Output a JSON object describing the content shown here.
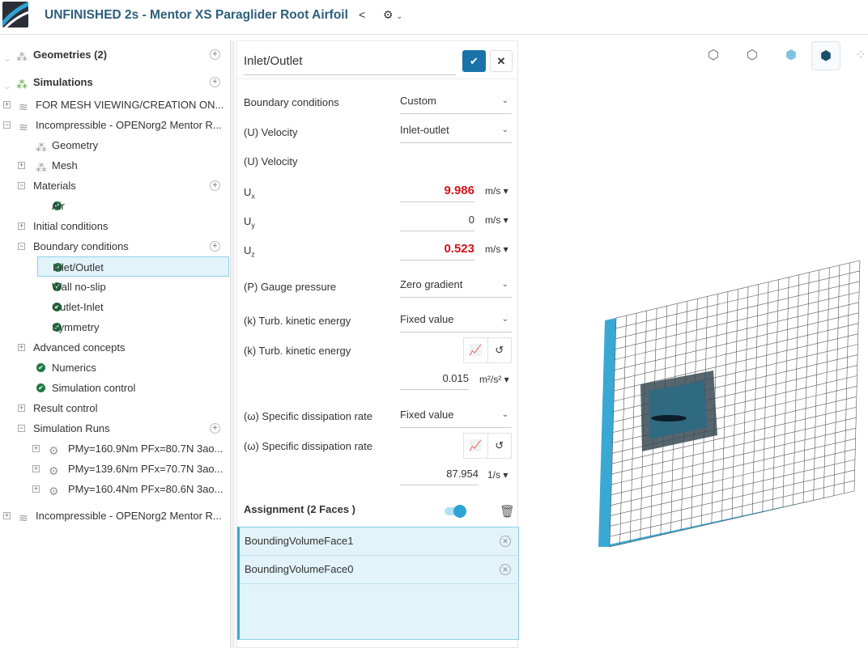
{
  "header": {
    "title": "UNFINISHED 2s - Mentor XS Paraglider Root Airfoil"
  },
  "tree": [
    {
      "label": "Geometries (2)",
      "level": 0,
      "bold": true,
      "icon": "geometry-icon",
      "plus": true,
      "collapse": true
    },
    {
      "label": "Simulations",
      "level": 0,
      "bold": true,
      "icon": "simulations-icon",
      "plus": true,
      "collapse": true
    },
    {
      "label": "FOR MESH VIEWING/CREATION ON...",
      "level": 1,
      "exp": "+",
      "icon": "layers-icon"
    },
    {
      "label": "Incompressible - OPENorg2 Mentor R...",
      "level": 1,
      "exp": "-",
      "icon": "layers-icon"
    },
    {
      "label": "Geometry",
      "level": 2,
      "icon": "geometry-check-icon"
    },
    {
      "label": "Mesh",
      "level": 2,
      "exp": "+",
      "icon": "mesh-warning-icon"
    },
    {
      "label": "Materials",
      "level": 2,
      "exp": "-",
      "plus": true
    },
    {
      "label": "Air",
      "level": 3,
      "check": true
    },
    {
      "label": "Initial conditions",
      "level": 2,
      "exp": "+"
    },
    {
      "label": "Boundary conditions",
      "level": 2,
      "exp": "-",
      "plus": true
    },
    {
      "label": "Inlet/Outlet",
      "level": 3,
      "check": true,
      "selected": true
    },
    {
      "label": "Wall no-slip",
      "level": 3,
      "check": true
    },
    {
      "label": "Outlet-Inlet",
      "level": 3,
      "check": true
    },
    {
      "label": "Symmetry",
      "level": 3,
      "check": true
    },
    {
      "label": "Advanced concepts",
      "level": 2,
      "exp": "+"
    },
    {
      "label": "Numerics",
      "level": 2,
      "check": true
    },
    {
      "label": "Simulation control",
      "level": 2,
      "check": true
    },
    {
      "label": "Result control",
      "level": 2,
      "exp": "+"
    },
    {
      "label": "Simulation Runs",
      "level": 2,
      "exp": "-",
      "plus": true
    },
    {
      "label": "PMy=160.9Nm PFx=80.7N 3ao...",
      "level": 3,
      "exp": "+",
      "icon": "run-gear-icon"
    },
    {
      "label": "PMy=139.6Nm PFx=70.7N 3ao...",
      "level": 3,
      "exp": "+",
      "icon": "run-gear-icon"
    },
    {
      "label": "PMy=160.4Nm PFx=80.6N 3ao...",
      "level": 3,
      "exp": "+",
      "icon": "run-gear-icon"
    },
    {
      "label": "Incompressible - OPENorg2 Mentor R...",
      "level": 1,
      "exp": "+",
      "icon": "layers-icon"
    }
  ],
  "panel": {
    "title": "Inlet/Outlet",
    "bc_label": "Boundary conditions",
    "bc_value": "Custom",
    "vel_label": "(U) Velocity",
    "vel_value": "Inlet-outlet",
    "vel_label2": "(U) Velocity",
    "ux_label": "U",
    "ux_sub": "x",
    "ux_value": "9.986",
    "ux_unit": "m/s",
    "uy_label": "U",
    "uy_sub": "y",
    "uy_value": "0",
    "uy_unit": "m/s",
    "uz_label": "U",
    "uz_sub": "z",
    "uz_value": "0.523",
    "uz_unit": "m/s",
    "p_label": "(P) Gauge pressure",
    "p_value": "Zero gradient",
    "k_label": "(k) Turb. kinetic energy",
    "k_value": "Fixed value",
    "k_label2": "(k) Turb. kinetic energy",
    "k_num": "0.015",
    "k_unit": "m²/s²",
    "w_label": "(ω) Specific dissipation rate",
    "w_value": "Fixed value",
    "w_label2": "(ω) Specific dissipation rate",
    "w_num": "87.954",
    "w_unit": "1/s",
    "assign_label": "Assignment (2 Faces )",
    "toggle_on": true,
    "faces": [
      "BoundingVolumeFace1",
      "BoundingVolumeFace0"
    ]
  },
  "colors": {
    "accent": "#1a73a8",
    "red": "#d0141b",
    "check": "#1e7a45",
    "face": "#39a9d4"
  }
}
